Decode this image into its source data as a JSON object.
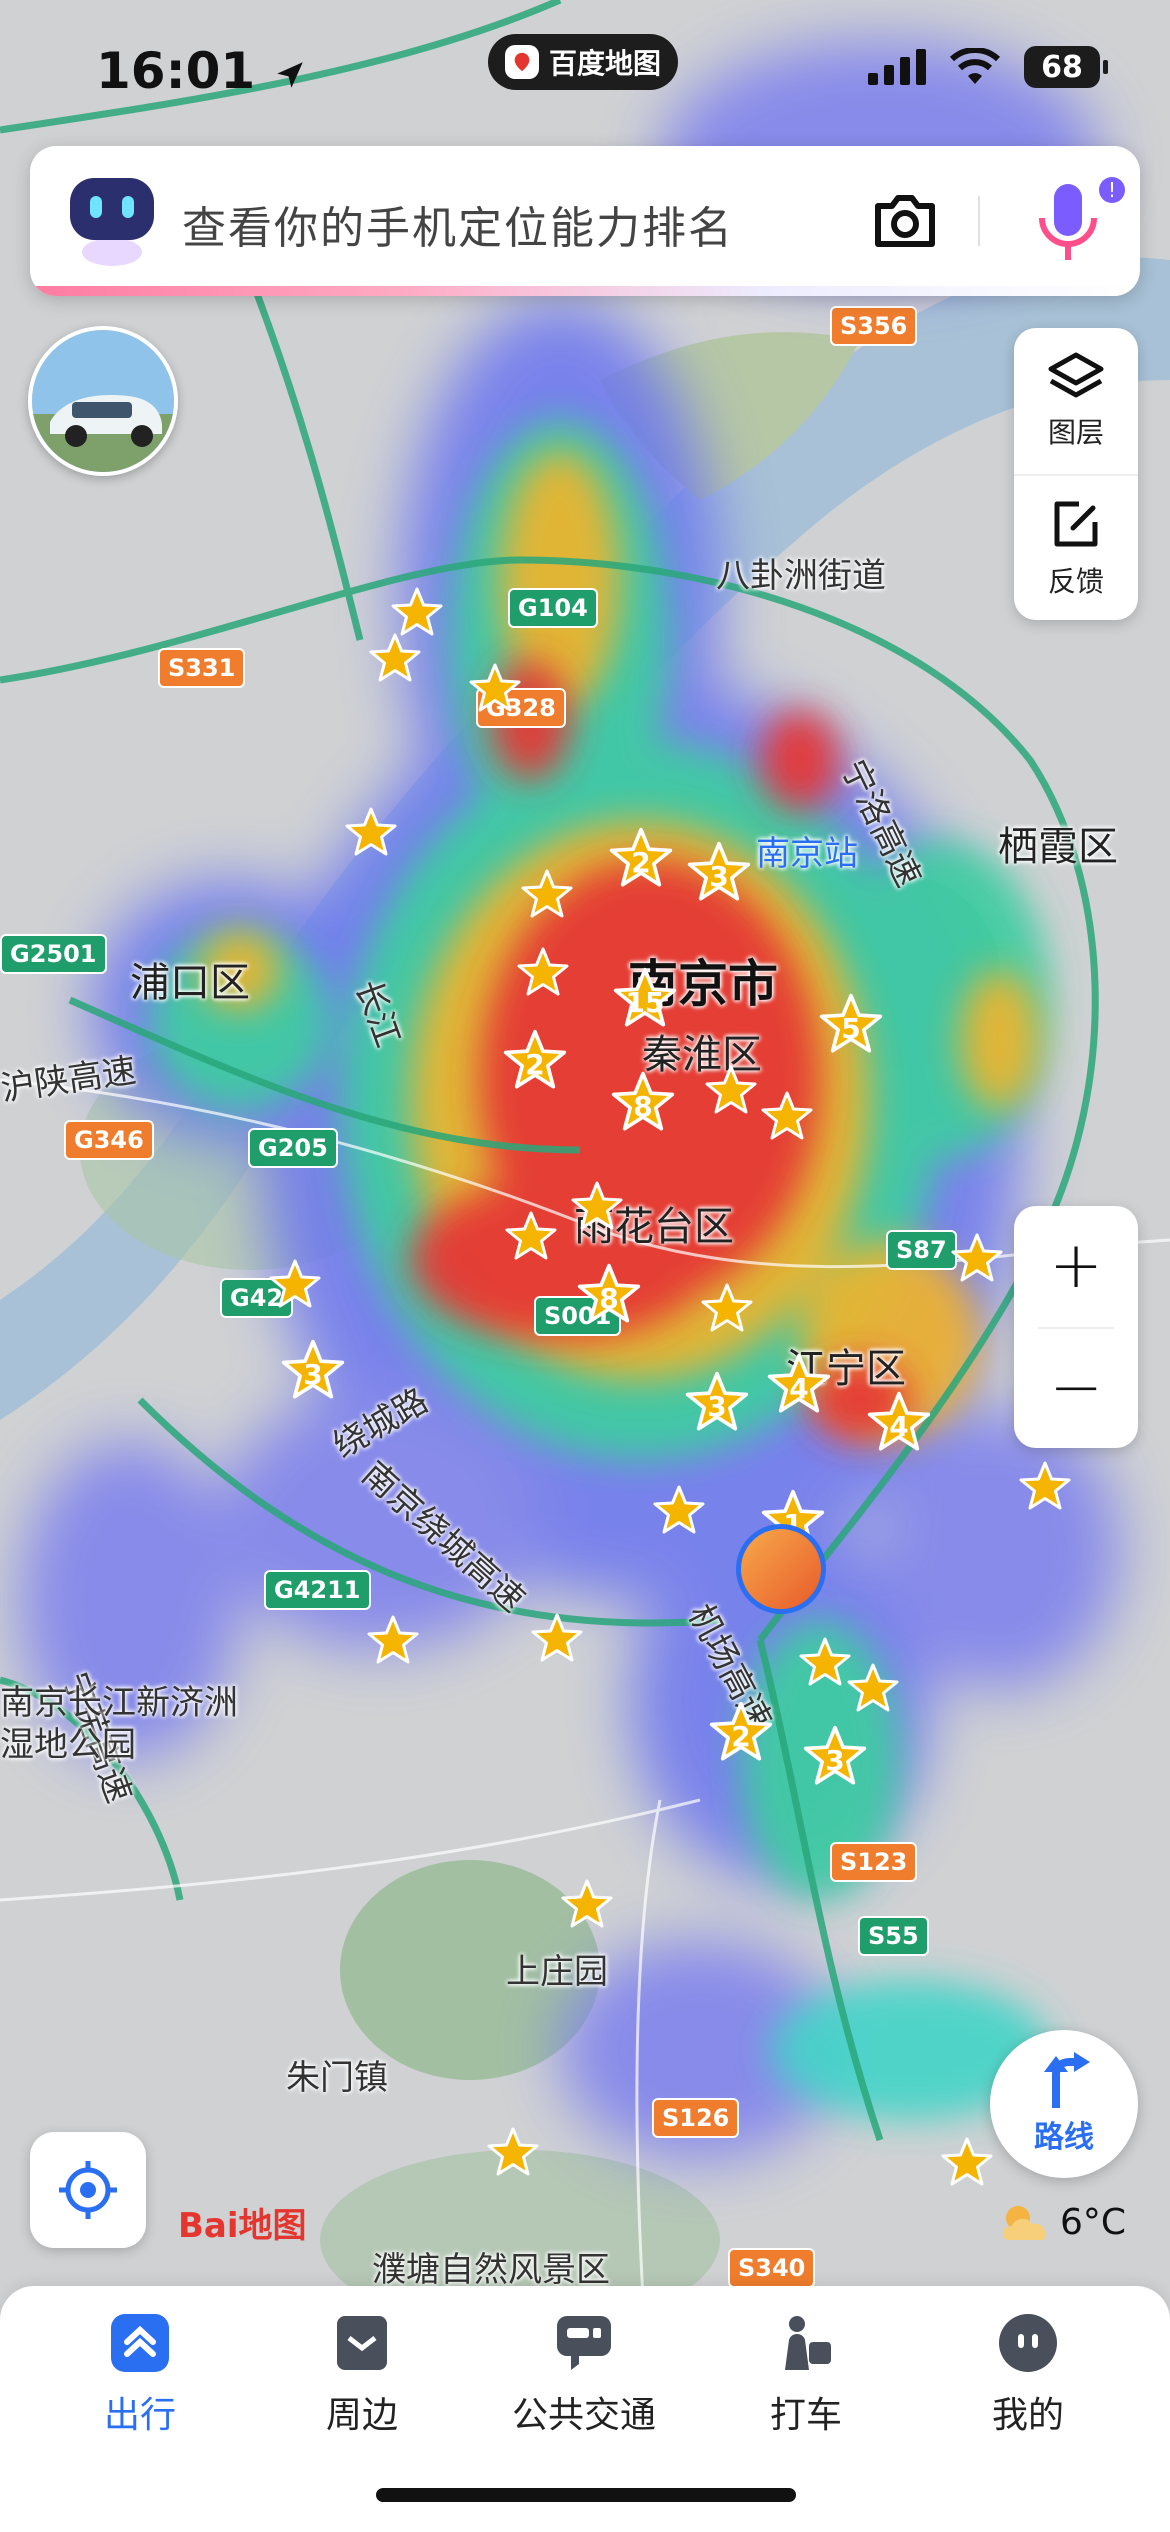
{
  "status_bar": {
    "time": "16:01",
    "app_name": "百度地图",
    "battery": "68"
  },
  "search": {
    "placeholder": "查看你的手机定位能力排名"
  },
  "side_tools": {
    "layers_label": "图层",
    "feedback_label": "反馈"
  },
  "zoom": {
    "in_label": "+",
    "out_label": "−"
  },
  "route_label": "路线",
  "weather": {
    "temp": "6°C"
  },
  "logo": {
    "text": "Bai地图"
  },
  "map_labels": {
    "city": "南京市",
    "districts": [
      "浦口区",
      "秦淮区",
      "雨花台区",
      "江宁区",
      "栖霞区"
    ],
    "station": "南京站",
    "street": "八卦洲街道",
    "roads": [
      "宁洛高速",
      "沪陕高速",
      "绕城路",
      "南京绕城高速",
      "机场高速",
      "宁芜高速",
      "长江"
    ],
    "parks": [
      "上庄园",
      "朱门镇",
      "南京长江新济洲湿地公园",
      "濮塘自然风景区"
    ]
  },
  "shields": [
    "S356",
    "G104",
    "S331",
    "G2501",
    "G346",
    "G205",
    "G42",
    "S87",
    "S001",
    "G4211",
    "S123",
    "S55",
    "S126",
    "S340",
    "G328"
  ],
  "star_counts": [
    "2",
    "3",
    "15",
    "2",
    "8",
    "5",
    "8",
    "3",
    "3",
    "4",
    "4",
    "2",
    "3",
    "1"
  ],
  "tabs": [
    {
      "label": "出行",
      "icon": "travel-icon",
      "active": true
    },
    {
      "label": "周边",
      "icon": "nearby-icon",
      "active": false
    },
    {
      "label": "公共交通",
      "icon": "bus-icon",
      "active": false
    },
    {
      "label": "打车",
      "icon": "taxi-icon",
      "active": false
    },
    {
      "label": "我的",
      "icon": "profile-icon",
      "active": false
    }
  ],
  "colors": {
    "accent": "#2a6ff2",
    "heat_high": "#e53935",
    "heat_mid": "#f2b42a",
    "heat_low": "#5c6bf0"
  }
}
